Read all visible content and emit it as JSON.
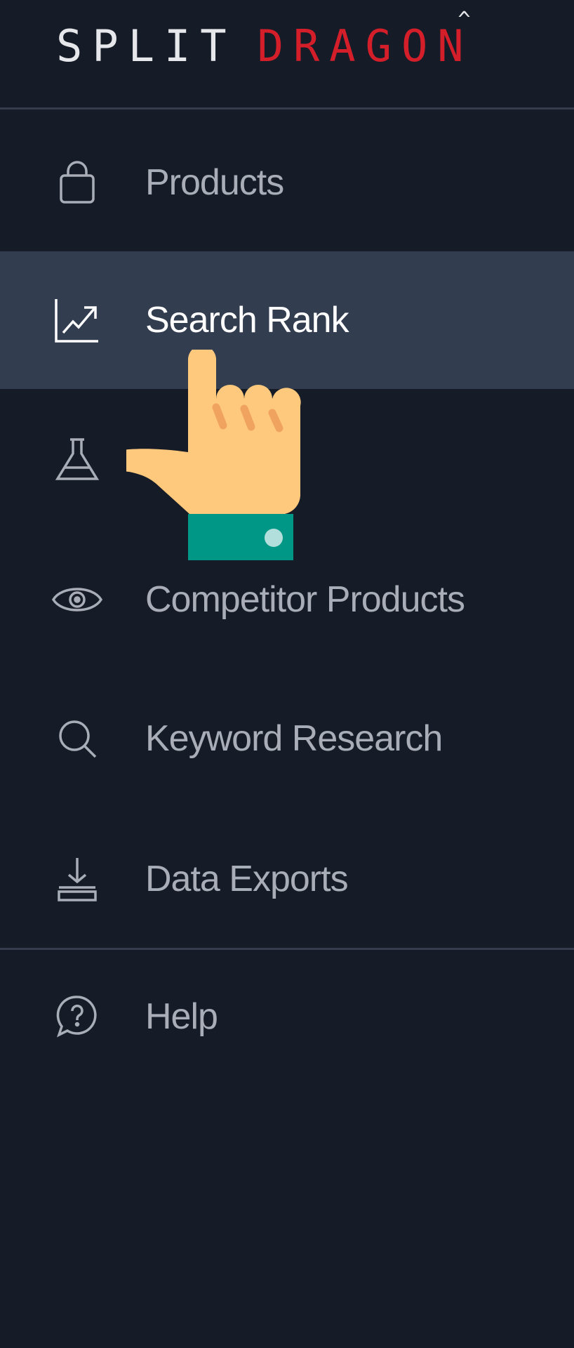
{
  "brand": {
    "part1": "SPLIT",
    "part2": "DRAGON",
    "accent_color": "#d41f2a"
  },
  "nav": {
    "items": [
      {
        "label": "Products",
        "icon": "shopping-bag-icon",
        "active": false
      },
      {
        "label": "Search Rank",
        "icon": "trending-up-chart-icon",
        "active": true
      },
      {
        "label": "",
        "icon": "flask-icon",
        "active": false
      },
      {
        "label": "Competitor Products",
        "icon": "eye-icon",
        "active": false
      },
      {
        "label": "Keyword Research",
        "icon": "search-icon",
        "active": false
      },
      {
        "label": "Data Exports",
        "icon": "download-tray-icon",
        "active": false
      }
    ],
    "footer_items": [
      {
        "label": "Help",
        "icon": "help-chat-icon",
        "active": false
      }
    ]
  },
  "colors": {
    "background": "#161c27",
    "active_background": "#333d50",
    "text": "#a9adb8",
    "active_text": "#ffffff"
  }
}
